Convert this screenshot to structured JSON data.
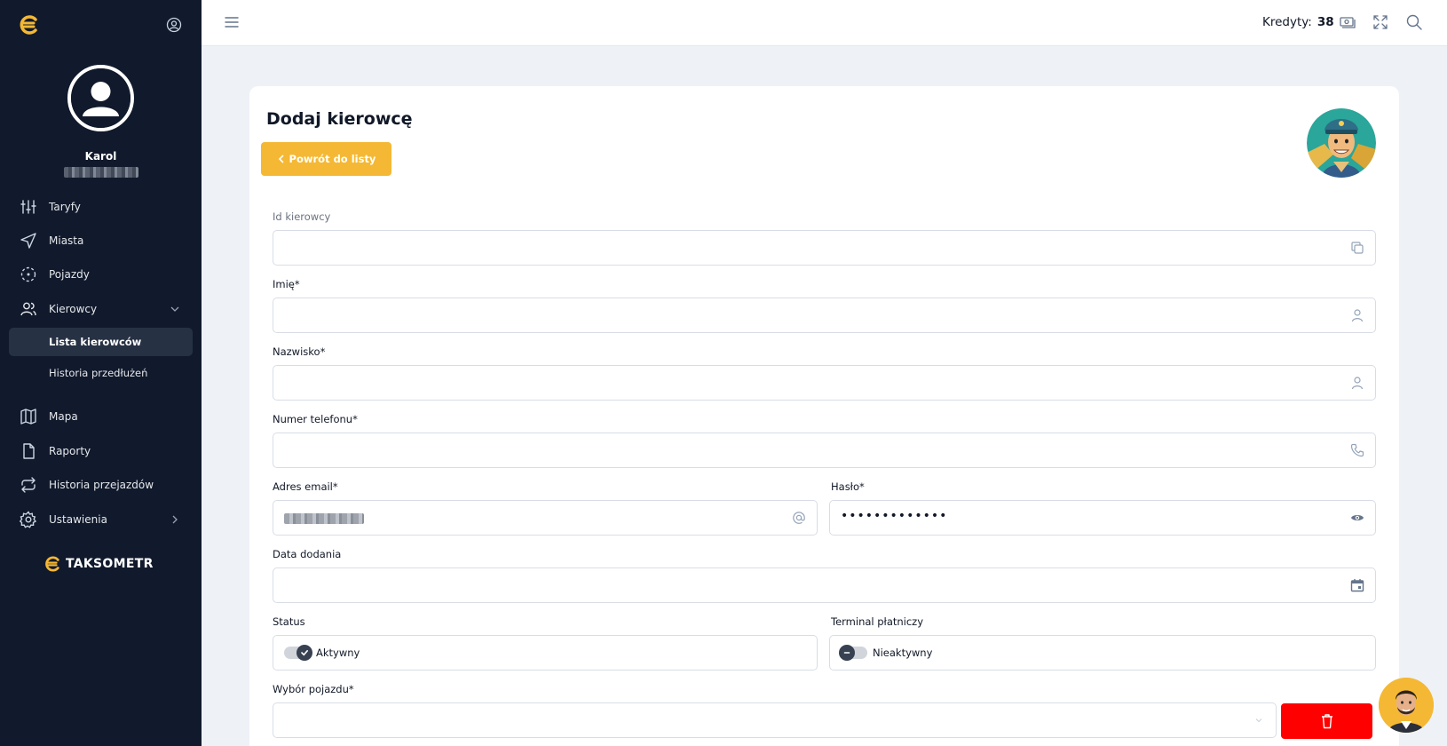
{
  "sidebar": {
    "user_name": "Karol",
    "nav": [
      {
        "label": "Taryfy",
        "icon": "sliders-icon"
      },
      {
        "label": "Miasta",
        "icon": "navigation-icon"
      },
      {
        "label": "Pojazdy",
        "icon": "vehicle-icon"
      },
      {
        "label": "Kierowcy",
        "icon": "users-icon"
      },
      {
        "label": "Mapa",
        "icon": "map-icon"
      },
      {
        "label": "Raporty",
        "icon": "file-icon"
      },
      {
        "label": "Historia przejazdów",
        "icon": "repeat-icon"
      },
      {
        "label": "Ustawienia",
        "icon": "gear-icon"
      }
    ],
    "subnav": [
      {
        "label": "Lista kierowców",
        "active": true
      },
      {
        "label": "Historia przedłużeń",
        "active": false
      }
    ],
    "brand": "TAKSOMETR"
  },
  "topbar": {
    "credits_label": "Kredyty:",
    "credits_value": "38"
  },
  "form": {
    "title": "Dodaj kierowcę",
    "back_label": "Powrót do listy",
    "id_label": "Id kierowcy",
    "first_name_label": "Imię*",
    "last_name_label": "Nazwisko*",
    "phone_label": "Numer telefonu*",
    "email_label": "Adres email*",
    "password_label": "Hasło*",
    "password_value": "•••••••••••••",
    "date_label": "Data dodania",
    "status_label": "Status",
    "status_value": "Aktywny",
    "terminal_label": "Terminal płatniczy",
    "terminal_value": "Nieaktywny",
    "vehicle_label": "Wybór pojazdu*"
  },
  "colors": {
    "sidebar_bg": "#111a2c",
    "accent": "#f5b834",
    "danger": "#ff0000"
  }
}
